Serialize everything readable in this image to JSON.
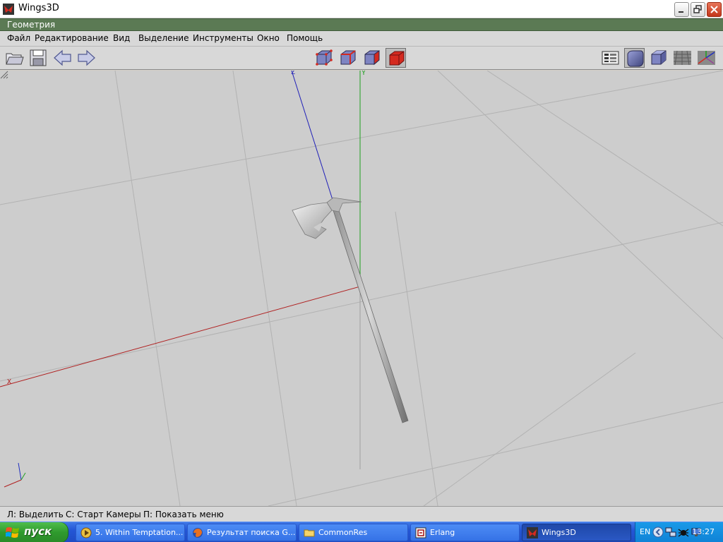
{
  "window": {
    "title": "Wings3D"
  },
  "geometry_strip": {
    "label": "Геометрия"
  },
  "menu": {
    "items": [
      "Файл",
      "Редактирование",
      "Вид",
      "Выделение",
      "Инструменты",
      "Окно",
      "Помощь"
    ]
  },
  "toolbar": {
    "left_icons": [
      "open-folder-icon",
      "save-disk-icon",
      "undo-arrow-icon",
      "redo-arrow-icon"
    ],
    "selection_modes": [
      "vertex-select-icon",
      "edge-select-icon",
      "face-select-icon",
      "body-select-icon"
    ],
    "selected_mode": "body-select-icon",
    "right_icons": [
      "outliner-icon",
      "smooth-shading-icon",
      "flat-shading-icon",
      "ground-grid-icon",
      "axes-icon"
    ],
    "accent_color": "#d42a20"
  },
  "viewport": {
    "axis_labels": {
      "x": "X",
      "y": "Y",
      "z": "Z"
    },
    "axis_colors": {
      "x": "#b02020",
      "y": "#20a020",
      "z": "#2020b8"
    },
    "background": "#cdcdcd",
    "object": "axe"
  },
  "status": {
    "hints": [
      "Л: Выделить",
      "С: Старт Камеры",
      "П: Показать меню"
    ]
  },
  "taskbar": {
    "start_label": "пуск",
    "tasks": [
      {
        "label": "5. Within Temptation...",
        "icon": "media-player-icon",
        "active": false
      },
      {
        "label": "Результат поиска G...",
        "icon": "firefox-icon",
        "active": false
      },
      {
        "label": "CommonRes",
        "icon": "folder-icon",
        "active": false
      },
      {
        "label": "Erlang",
        "icon": "erlang-icon",
        "active": false
      },
      {
        "label": "Wings3D",
        "icon": "wings3d-icon",
        "active": true
      }
    ],
    "tray": {
      "language": "EN",
      "time": "13:27"
    }
  }
}
